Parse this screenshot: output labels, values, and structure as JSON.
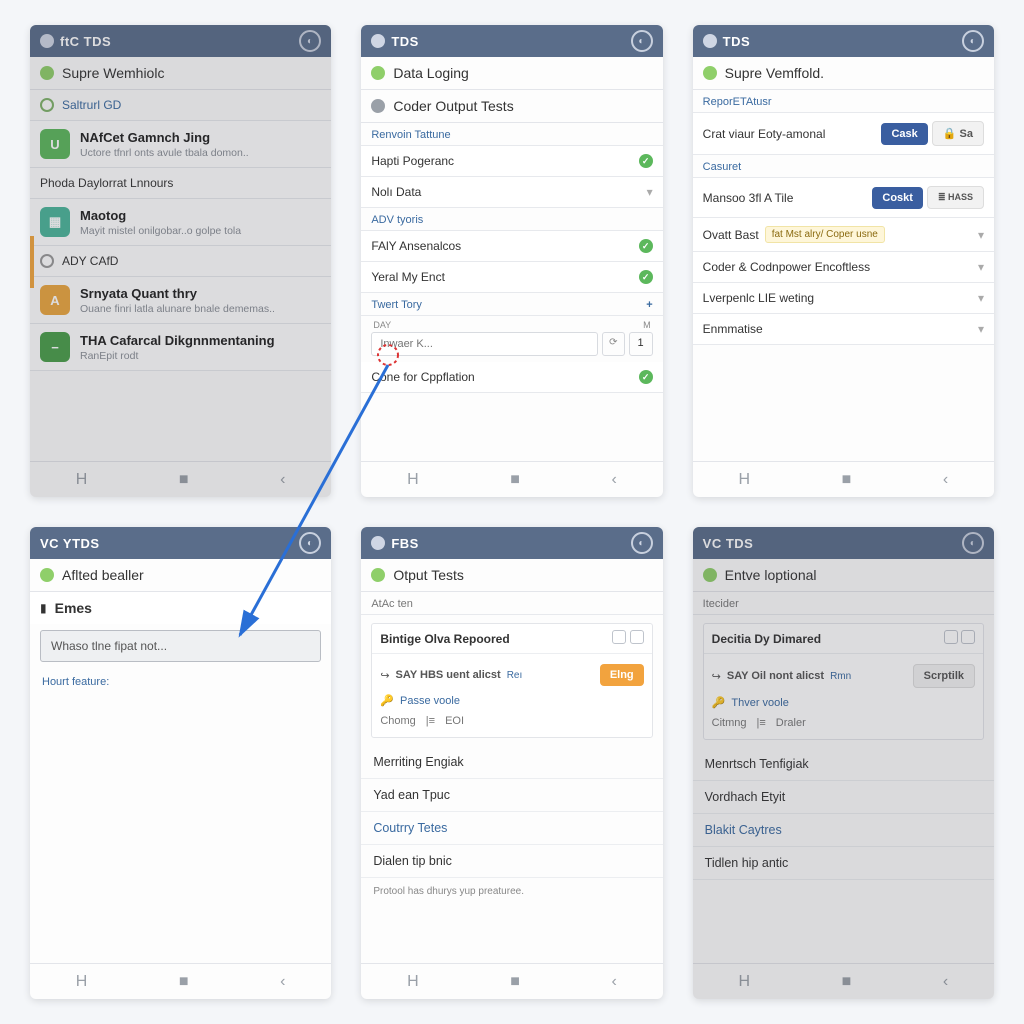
{
  "screens": {
    "s1": {
      "titlebar": "ftC TDS",
      "header": "Supre Wemhiolc",
      "section": "Saltrurl GD",
      "items": [
        {
          "title": "NAfCet Gamnch Jing",
          "sub": "Uctore tfnrl onts avule tbala domon.."
        },
        {
          "plain": "Phoda Daylorrat Lnnours"
        },
        {
          "title": "Maotog",
          "sub": "Mayit mistel onilgobar..o golpe tola"
        },
        {
          "plain": "ADY CAfD"
        },
        {
          "title": "Srnyata Quant thry",
          "sub": "Ouane finri latla alunare bnale dememas.."
        },
        {
          "title": "THA Cafarcal Dikgnnmentaning",
          "sub": "RanEpit rodt"
        }
      ]
    },
    "s2": {
      "titlebar": "TDS",
      "header1": "Data Loging",
      "header2": "Coder Output Tests",
      "groups": [
        {
          "label": "Renvoin Tattune",
          "rows": [
            {
              "text": "Hapti Pogeranc",
              "check": true
            },
            {
              "text": "Nolı Data",
              "chev": true
            }
          ]
        },
        {
          "label": "ADV tyoris",
          "rows": [
            {
              "text": "FAlY Ansenalcos",
              "check": true
            },
            {
              "text": "Yeral My Enct",
              "check": true
            }
          ]
        },
        {
          "label": "Twert Tory",
          "plus": true
        }
      ],
      "col_day": "DAY",
      "col_m": "M",
      "input_ph": "Inwaer K...",
      "spin_val": "1",
      "final_row": "Cone for Cppflation"
    },
    "s3": {
      "titlebar": "TDS",
      "header": "Supre Vemffold.",
      "sec1": "ReporETAtusr",
      "row1_text": "Crat viaur Eoty-amonal",
      "btn_cask": "Cask",
      "btn_sa": "Sa",
      "sec2": "Casuret",
      "row2_text": "Mansoo 3fl A Tile",
      "btn_coskt": "Coskt",
      "btn_hass": "HASS",
      "row3_text": "Ovatt Bast",
      "row3_pill": "fat Mst alry/ Coper usne",
      "rows_rest": [
        "Coder & Codnpower Encoftless",
        "Lverpenlc LIE weting",
        "Enmmatise"
      ]
    },
    "s4": {
      "titlebar": "VC YTDS",
      "header": "Aflted bealler",
      "sub_icon_label": "Emes",
      "input_text": "Whaso tlne fipat not...",
      "hourt": "Hourt feature:"
    },
    "s5": {
      "titlebar": "FBS",
      "header": "Otput Tests",
      "sec": "AtAc ten",
      "card_title": "Bintige Olva Repoored",
      "say_line": "SAY HBS uent alicst",
      "say_tag": "Reı",
      "btn_elng": "Elng",
      "passe": "Passe voole",
      "chomg": "Chomg",
      "eoi": "EOI",
      "rows": [
        "Merriting Engiak",
        "Yad ean Tpuc",
        "Coutrry Tetes",
        "Dialen tip bnic"
      ],
      "footer": "Protool has dhurys yup preaturee."
    },
    "s6": {
      "titlebar": "VC TDS",
      "header": "Entve loptional",
      "sec": "Itecider",
      "card_title": "Decitia Dy Dimared",
      "say_line": "SAY Oil nont alicst",
      "say_tag": "Rmn",
      "btn_scrpt": "Scrptilk",
      "thver": "Thver voole",
      "citmng": "Citmng",
      "draler": "Draler",
      "rows": [
        "Menrtsch Tenfigiak",
        "Vordhach Etyit",
        "Blakit Caytres",
        "Tidlen hip antic"
      ]
    },
    "nav": {
      "h": "H",
      "mid": "■",
      "back": "‹"
    }
  }
}
